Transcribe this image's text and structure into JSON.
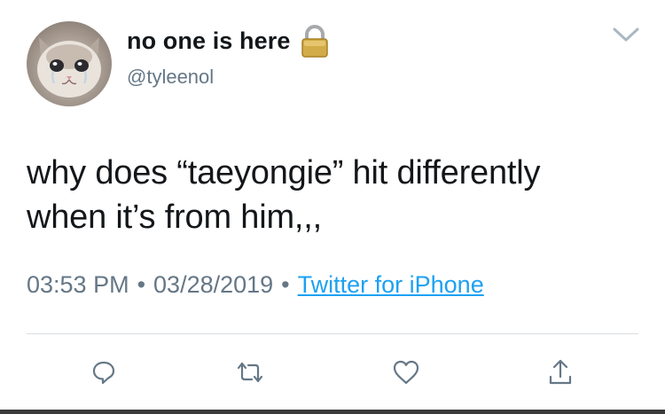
{
  "tweet": {
    "display_name": "no one is here",
    "handle": "@tyleenol",
    "text_lines": [
      "why does “taeyongie” hit differently",
      "when it’s from him,,,"
    ],
    "time": "03:53 PM",
    "date": "03/28/2019",
    "separator": "•",
    "source": "Twitter for iPhone"
  },
  "icons": {
    "avatar": "crying-cat-avatar",
    "protected": "lock-icon",
    "menu": "chevron-down-icon",
    "reply": "reply-icon",
    "retweet": "retweet-icon",
    "like": "heart-icon",
    "share": "share-icon"
  },
  "colors": {
    "text": "#14171a",
    "secondary": "#657786",
    "link": "#1da1f2",
    "divider": "#d8dde1",
    "lock": "#c9a33b"
  }
}
